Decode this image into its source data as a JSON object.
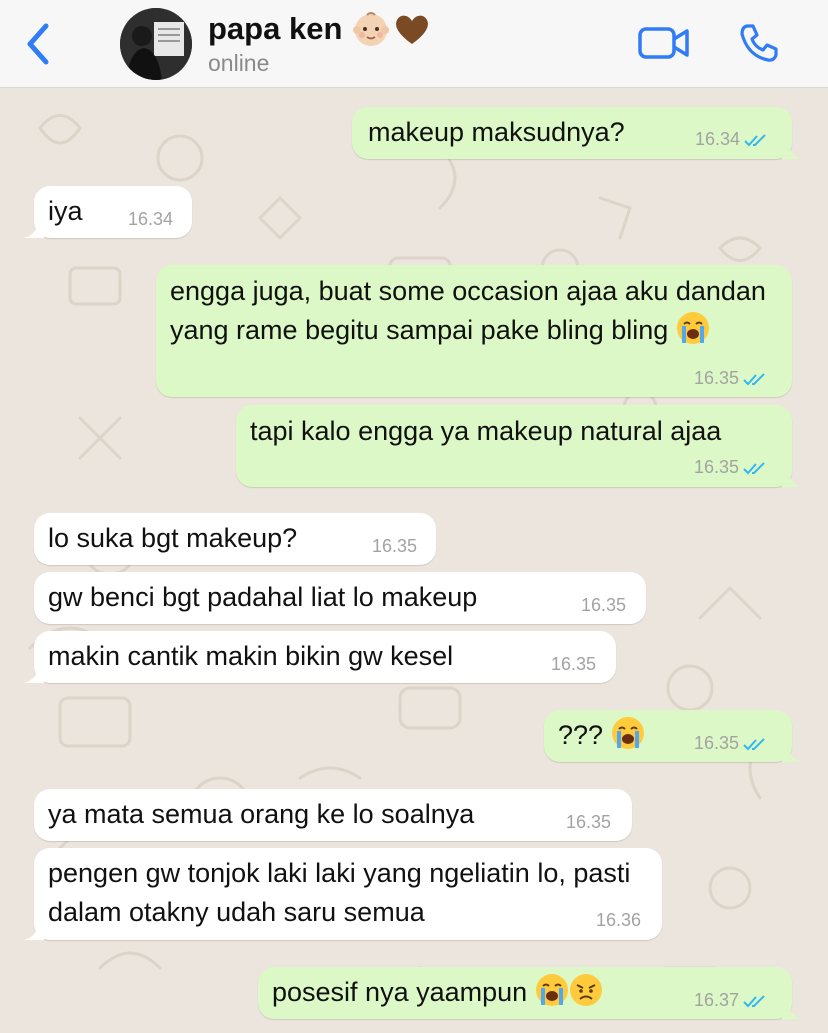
{
  "header": {
    "contact_name": "papa ken",
    "status": "online",
    "name_emojis": [
      "baby-emoji",
      "brown-heart-emoji"
    ]
  },
  "colors": {
    "accent": "#2F7CF6",
    "outgoing_bubble": "#DCF8C6",
    "incoming_bubble": "#FFFFFF",
    "chat_background": "#ECE5DD",
    "read_ticks": "#34B7F1"
  },
  "messages": [
    {
      "dir": "out",
      "text": "makeup maksudnya?",
      "time": "16.34",
      "read": true
    },
    {
      "dir": "in",
      "text": "iya",
      "time": "16.34"
    },
    {
      "dir": "out",
      "text": "engga juga, buat some occasion ajaa aku dandan yang rame begitu sampai pake bling bling",
      "emoji": "loudly-crying-face",
      "time": "16.35",
      "read": true
    },
    {
      "dir": "out",
      "text": "tapi kalo engga ya makeup natural ajaa",
      "time": "16.35",
      "read": true
    },
    {
      "dir": "in",
      "text": "lo suka bgt makeup?",
      "time": "16.35"
    },
    {
      "dir": "in",
      "text": "gw benci bgt padahal liat lo makeup",
      "time": "16.35"
    },
    {
      "dir": "in",
      "text": "makin cantik makin bikin gw kesel",
      "time": "16.35"
    },
    {
      "dir": "out",
      "text": "???",
      "emoji": "loudly-crying-face",
      "time": "16.35",
      "read": true
    },
    {
      "dir": "in",
      "text": "ya mata semua orang ke lo soalnya",
      "time": "16.35"
    },
    {
      "dir": "in",
      "text": "pengen gw tonjok laki laki yang ngeliatin lo, pasti dalam otakny udah saru semua",
      "time": "16.36"
    },
    {
      "dir": "out",
      "text": "posesif nya yaampun",
      "emoji": "loudly-crying-face disappointed-face",
      "time": "16.37",
      "read": true
    }
  ]
}
